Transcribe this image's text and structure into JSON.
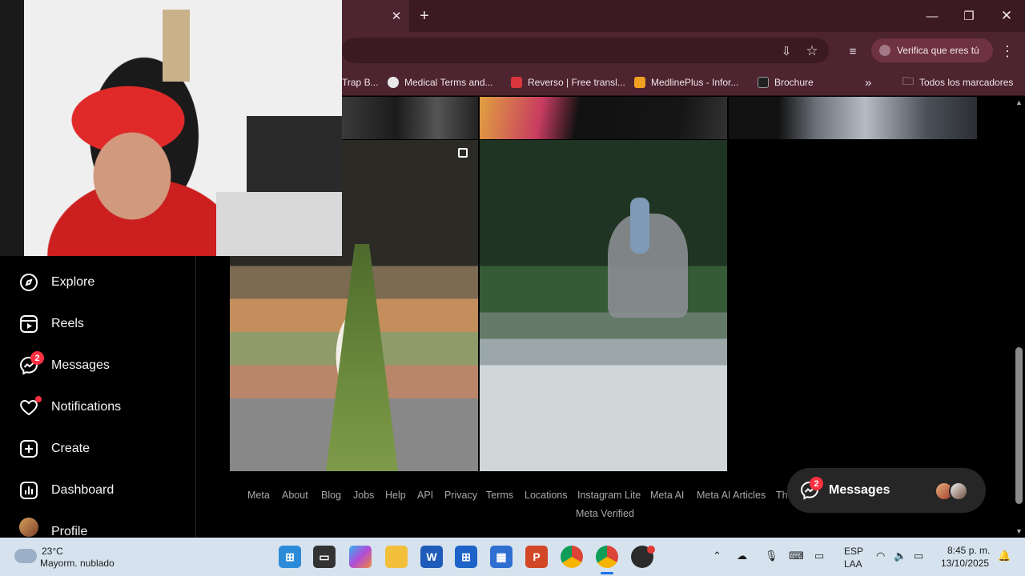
{
  "browser": {
    "bookmarks": [
      {
        "label": "Trap B...",
        "color": "#444444"
      },
      {
        "label": "Medical Terms and...",
        "color": "#e9e9e9"
      },
      {
        "label": "Reverso | Free transl...",
        "color": "#d9363e"
      },
      {
        "label": "MedlinePlus - Infor...",
        "color": "#f0a020"
      },
      {
        "label": "Brochure",
        "color": "#222222"
      }
    ],
    "all_bookmarks_label": "Todos los marcadores",
    "profile_label": "Verifica que eres tú"
  },
  "sidebar": {
    "items": [
      {
        "label": "Explore",
        "icon": "compass-icon"
      },
      {
        "label": "Reels",
        "icon": "reels-icon"
      },
      {
        "label": "Messages",
        "icon": "messenger-icon",
        "badge": "2"
      },
      {
        "label": "Notifications",
        "icon": "heart-icon"
      },
      {
        "label": "Create",
        "icon": "plus-square-icon"
      },
      {
        "label": "Dashboard",
        "icon": "dashboard-icon"
      },
      {
        "label": "Profile",
        "icon": "avatar"
      }
    ]
  },
  "footer": {
    "links": [
      "Meta",
      "About",
      "Blog",
      "Jobs",
      "Help",
      "API",
      "Privacy",
      "Terms",
      "Locations",
      "Instagram Lite",
      "Meta AI",
      "Meta AI Articles",
      "Th"
    ],
    "second_line": "Meta Verified"
  },
  "messages_pill": {
    "label": "Messages",
    "badge": "2"
  },
  "taskbar": {
    "weather_temp": "23°C",
    "weather_desc": "Mayorm. nublado",
    "lang_top": "ESP",
    "lang_bottom": "LAA",
    "time": "8:45 p. m.",
    "date": "13/10/2025"
  },
  "colors": {
    "accent_red": "#ff3040",
    "chrome_bg": "#4d2430",
    "taskbar_bg": "#d6e3ef"
  }
}
